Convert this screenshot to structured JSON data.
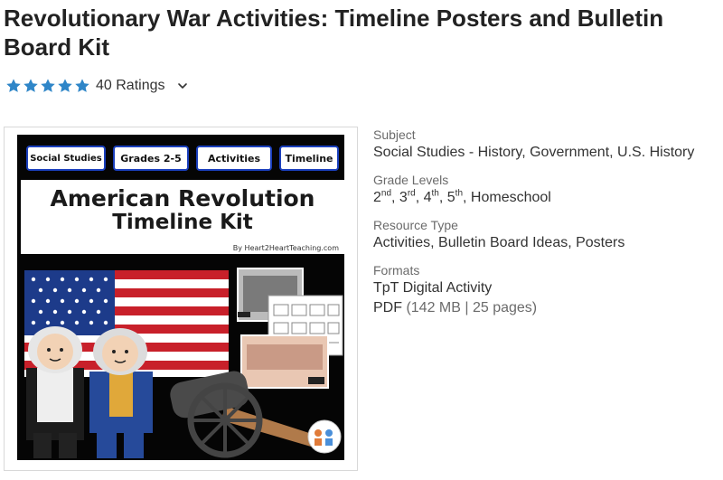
{
  "product": {
    "title": "Revolutionary War Activities: Timeline Posters and Bulletin Board Kit",
    "rating": {
      "stars": 5,
      "count_label": "40 Ratings",
      "star_color": "#2f86c8"
    }
  },
  "cover": {
    "tags": [
      "Social Studies",
      "Grades 2-5",
      "Activities",
      "Timeline"
    ],
    "title_line1": "American Revolution",
    "title_line2": "Timeline Kit",
    "credit": "By Heart2HeartTeaching.com"
  },
  "details": {
    "subject": {
      "label": "Subject",
      "value": "Social Studies - History, Government, U.S. History"
    },
    "grade_levels": {
      "label": "Grade Levels",
      "items": [
        {
          "num": "2",
          "sup": "nd",
          "sep": ", "
        },
        {
          "num": "3",
          "sup": "rd",
          "sep": ", "
        },
        {
          "num": "4",
          "sup": "th",
          "sep": ", "
        },
        {
          "num": "5",
          "sup": "th",
          "sep": ", "
        }
      ],
      "extra": "Homeschool"
    },
    "resource_type": {
      "label": "Resource Type",
      "value": "Activities, Bulletin Board Ideas, Posters"
    },
    "formats": {
      "label": "Formats",
      "item1": "TpT Digital Activity",
      "item2_name": "PDF",
      "item2_meta": "(142 MB | 25 pages)"
    }
  }
}
